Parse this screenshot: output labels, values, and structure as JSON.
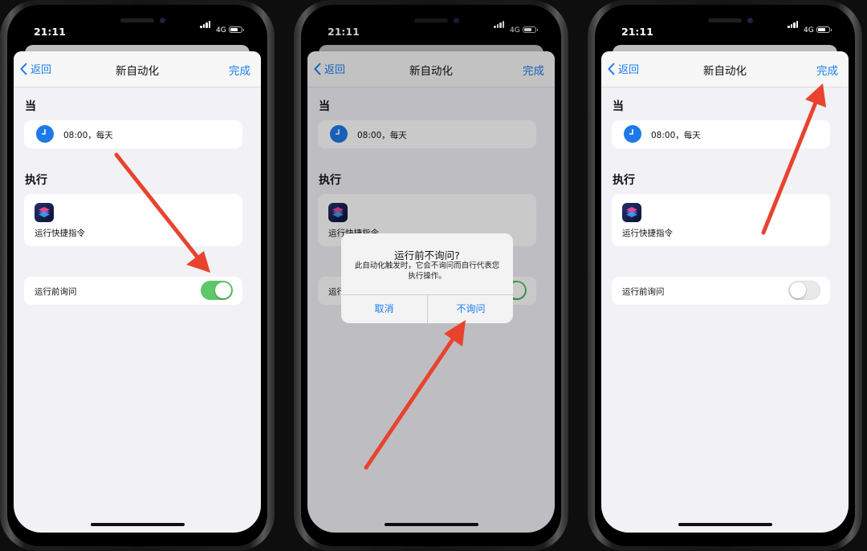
{
  "status_bar": {
    "time": "21:11",
    "network": "4G"
  },
  "nav": {
    "back_label": "返回",
    "title": "新自动化",
    "done_label": "完成"
  },
  "when_section": {
    "header": "当",
    "schedule": "08:00，每天"
  },
  "do_section": {
    "header": "执行",
    "action_label": "运行快捷指令"
  },
  "ask_before_running": {
    "label": "运行前询问",
    "states": [
      "on",
      "on",
      "off"
    ]
  },
  "alert": {
    "title": "运行前不询问?",
    "message": "此自动化触发时，它会不询问而自行代表您执行操作。",
    "cancel_label": "取消",
    "confirm_label": "不询问"
  },
  "colors": {
    "accent": "#1a7df0",
    "toggle_on": "#5fc66a",
    "arrow": "#e8432e"
  }
}
